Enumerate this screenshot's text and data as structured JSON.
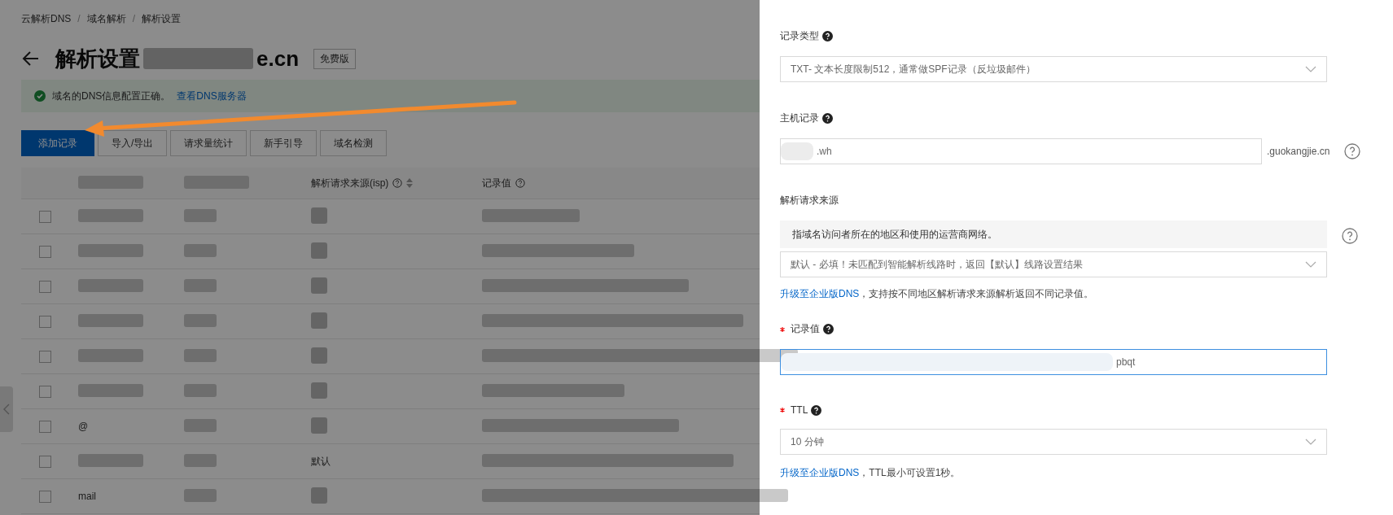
{
  "breadcrumb": {
    "items": [
      "云解析DNS",
      "域名解析",
      "解析设置"
    ],
    "separator": "/"
  },
  "header": {
    "title": "解析设置",
    "domain_visible": "e.cn",
    "edition_tag": "免费版"
  },
  "alert": {
    "message": "域名的DNS信息配置正确。",
    "link": "查看DNS服务器"
  },
  "toolbar": [
    {
      "label": "添加记录",
      "kind": "primary"
    },
    {
      "label": "导入/导出",
      "kind": "default"
    },
    {
      "label": "请求量统计",
      "kind": "default"
    },
    {
      "label": "新手引导",
      "kind": "default"
    },
    {
      "label": "域名检测",
      "kind": "default"
    }
  ],
  "table": {
    "columns": [
      {
        "label": "解析请求来源(isp)",
        "help": true,
        "sortable": true
      },
      {
        "label": "记录值",
        "help": true,
        "sortable": false
      }
    ],
    "rows": [
      {
        "checked": false,
        "redacted": true
      },
      {
        "checked": false,
        "redacted": true
      },
      {
        "checked": false,
        "redacted": true
      },
      {
        "checked": false,
        "redacted": true
      },
      {
        "checked": false,
        "redacted": true
      },
      {
        "checked": false,
        "redacted": true
      },
      {
        "host": "@",
        "checked": false,
        "redacted": true
      },
      {
        "isp": "默认",
        "checked": false,
        "redacted": true
      },
      {
        "host": "mail",
        "checked": false,
        "redacted": true
      }
    ]
  },
  "drawer": {
    "fields": [
      {
        "kind": "select",
        "label": "记录类型",
        "help": true,
        "required": false,
        "value": "TXT- 文本长度限制512，通常做SPF记录（反垃圾邮件）"
      },
      {
        "kind": "input",
        "label": "主机记录",
        "help": true,
        "required": false,
        "focused": false,
        "value": ".wh",
        "redacted": true,
        "suffix": ".guokangjie.cn",
        "side_help": true
      },
      {
        "kind": "select",
        "label": "解析请求来源",
        "help": false,
        "required": false,
        "info": "指域名访问者所在的地区和使用的运营商网络。",
        "side_help": true,
        "value": "默认 - 必填！未匹配到智能解析线路时，返回【默认】线路设置结果",
        "note_link": "升级至企业版DNS",
        "note": "，支持按不同地区解析请求来源解析返回不同记录值。"
      },
      {
        "kind": "input",
        "label": "记录值",
        "help": true,
        "required": true,
        "focused": true,
        "value": "pbqt",
        "redacted": true
      },
      {
        "kind": "select",
        "label": "TTL",
        "help": true,
        "required": true,
        "value": "10 分钟",
        "note_link": "升级至企业版DNS",
        "note": "，TTL最小可设置1秒。"
      }
    ]
  }
}
